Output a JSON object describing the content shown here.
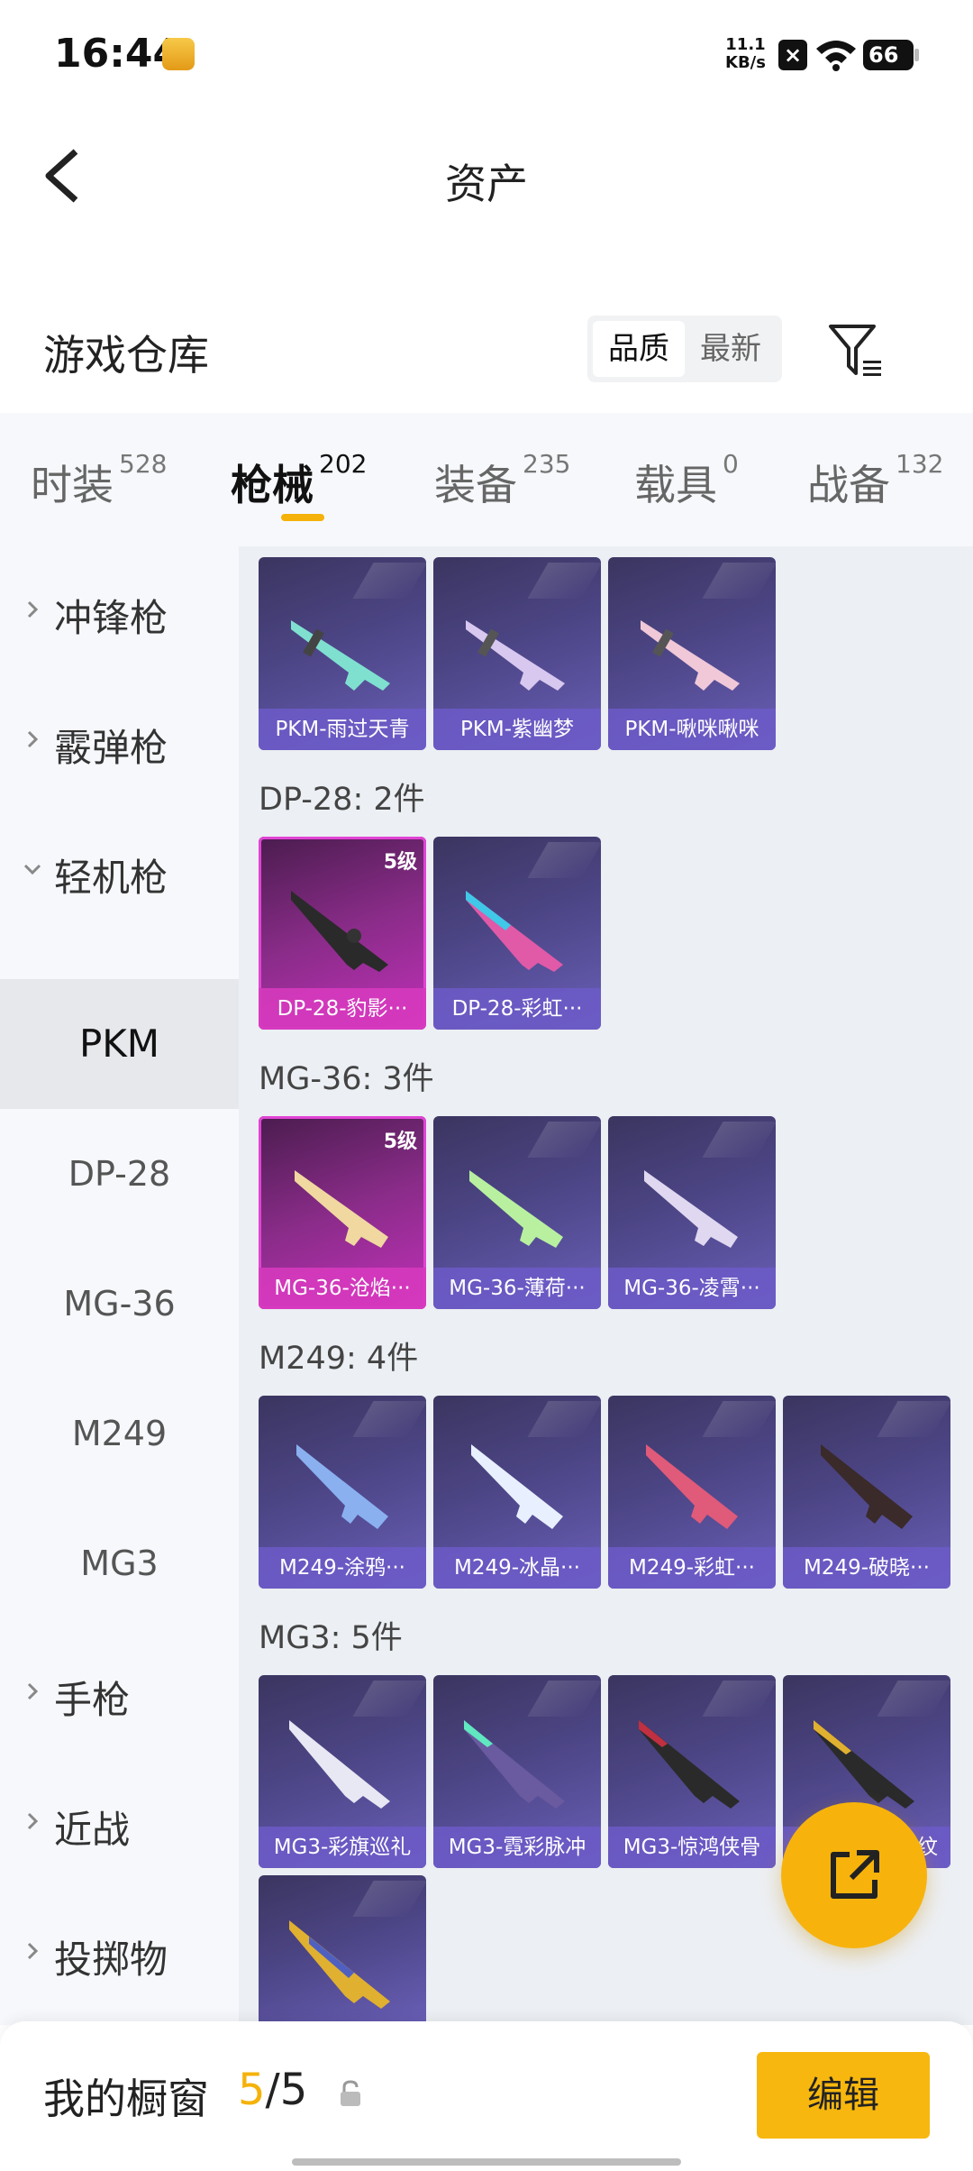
{
  "status": {
    "time": "16:44",
    "net_speed": "11.1",
    "net_unit": "KB/s",
    "battery": "66"
  },
  "header": {
    "title": "资产"
  },
  "repo": {
    "title": "游戏仓库",
    "sort_options": [
      "品质",
      "最新"
    ]
  },
  "tabs": [
    {
      "label": "时装",
      "count": "528"
    },
    {
      "label": "枪械",
      "count": "202"
    },
    {
      "label": "装备",
      "count": "235"
    },
    {
      "label": "载具",
      "count": "0"
    },
    {
      "label": "战备",
      "count": "132"
    }
  ],
  "sidebar": {
    "categories": [
      "冲锋枪",
      "霰弹枪",
      "轻机枪",
      "手枪",
      "近战",
      "投掷物"
    ],
    "subs": [
      "PKM",
      "DP-28",
      "MG-36",
      "M249",
      "MG3"
    ]
  },
  "groups": {
    "pkm": {
      "cards": [
        "PKM-雨过天青",
        "PKM-紫幽梦",
        "PKM-啾咪啾咪"
      ]
    },
    "dp28": {
      "label": "DP-28: 2件",
      "cards": [
        "DP-28-豹影···",
        "DP-28-彩虹···"
      ],
      "level": "5级"
    },
    "mg36": {
      "label": "MG-36: 3件",
      "cards": [
        "MG-36-沧焰···",
        "MG-36-薄荷···",
        "MG-36-凌霄···"
      ],
      "level": "5级"
    },
    "m249": {
      "label": "M249: 4件",
      "cards": [
        "M249-涂鸦···",
        "M249-冰晶···",
        "M249-彩虹···",
        "M249-破晓···"
      ]
    },
    "mg3": {
      "label": "MG3: 5件",
      "cards": [
        "MG3-彩旗巡礼",
        "MG3-霓彩脉冲",
        "MG3-惊鸿侠骨",
        "纹"
      ]
    }
  },
  "bottom": {
    "label": "我的橱窗",
    "current": "5",
    "total": "/5",
    "edit": "编辑"
  },
  "colors": {
    "accent": "#f4b20a",
    "card_purple": "#4c4585",
    "card_gold": "#c030b8"
  }
}
